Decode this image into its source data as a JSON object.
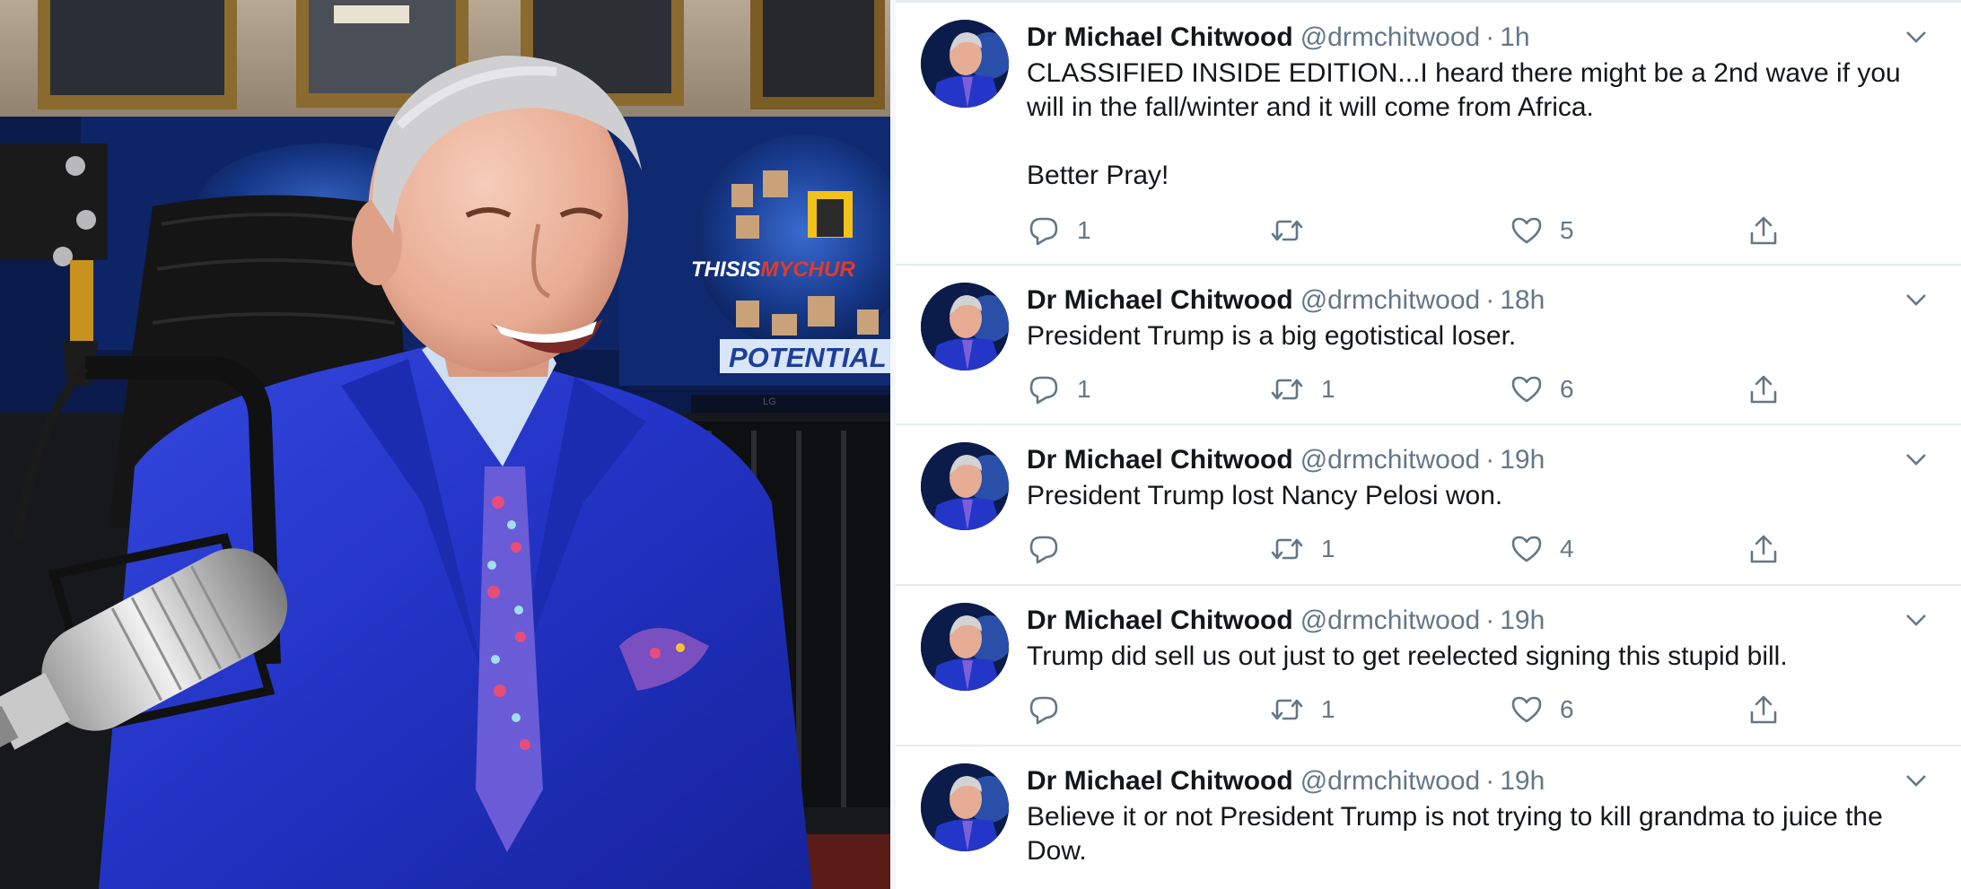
{
  "photo": {
    "screen_text_left": "THISIS",
    "screen_text_accent": "MYCHUR",
    "screen_banner": "POTENTIAL",
    "monitor_brand": "LG",
    "colors": {
      "suit": "#2234c9",
      "backdrop": "#0d2566",
      "accent": "#e23a2b"
    }
  },
  "feed": {
    "colors": {
      "text": "#14171a",
      "secondary": "#657786",
      "border": "#e6ecf0"
    },
    "tweets": [
      {
        "name": "Dr Michael Chitwood",
        "handle": "@drmchitwood",
        "separator": "·",
        "time": "1h",
        "text": "CLASSIFIED INSIDE EDITION...I heard there might be a 2nd wave if you will in the fall/winter and it will come from Africa.\n\nBetter Pray!",
        "replies": "1",
        "retweets": "",
        "likes": "5",
        "icons": [
          "reply-icon",
          "retweet-icon",
          "like-icon",
          "share-icon",
          "chevron-down-icon"
        ]
      },
      {
        "name": "Dr Michael Chitwood",
        "handle": "@drmchitwood",
        "separator": "·",
        "time": "18h",
        "text": "President Trump is a big egotistical loser.",
        "replies": "1",
        "retweets": "1",
        "likes": "6",
        "icons": [
          "reply-icon",
          "retweet-icon",
          "like-icon",
          "share-icon",
          "chevron-down-icon"
        ]
      },
      {
        "name": "Dr Michael Chitwood",
        "handle": "@drmchitwood",
        "separator": "·",
        "time": "19h",
        "text": "President Trump lost Nancy Pelosi won.",
        "replies": "",
        "retweets": "1",
        "likes": "4",
        "icons": [
          "reply-icon",
          "retweet-icon",
          "like-icon",
          "share-icon",
          "chevron-down-icon"
        ]
      },
      {
        "name": "Dr Michael Chitwood",
        "handle": "@drmchitwood",
        "separator": "·",
        "time": "19h",
        "text": "Trump did sell us out just to get reelected signing this stupid bill.",
        "replies": "",
        "retweets": "1",
        "likes": "6",
        "icons": [
          "reply-icon",
          "retweet-icon",
          "like-icon",
          "share-icon",
          "chevron-down-icon"
        ]
      },
      {
        "name": "Dr Michael Chitwood",
        "handle": "@drmchitwood",
        "separator": "·",
        "time": "19h",
        "text": "Believe it or not President Trump is not trying to kill grandma to juice the Dow.",
        "replies": "",
        "retweets": "",
        "likes": "",
        "icons": [
          "chevron-down-icon"
        ]
      }
    ]
  }
}
